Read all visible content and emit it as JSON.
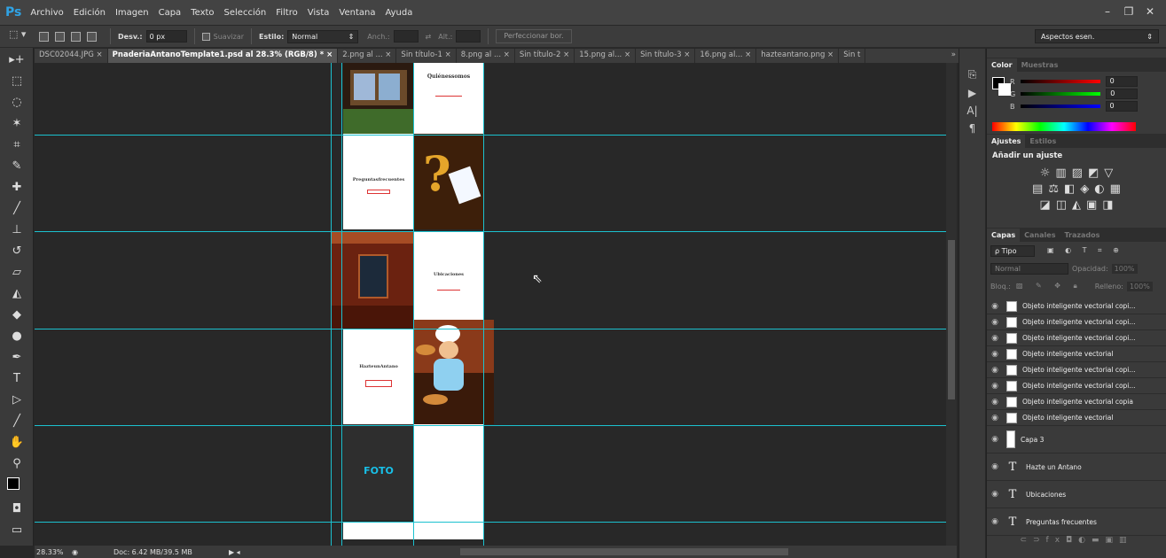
{
  "app": {
    "logo": "Ps",
    "menus": [
      "Archivo",
      "Edición",
      "Imagen",
      "Capa",
      "Texto",
      "Selección",
      "Filtro",
      "Vista",
      "Ventana",
      "Ayuda"
    ]
  },
  "window_controls": {
    "minimize": "–",
    "restore": "❐",
    "close": "✕"
  },
  "options": {
    "desv_label": "Desv.:",
    "desv_value": "0 px",
    "suavizar_label": "Suavizar",
    "estilo_label": "Estilo:",
    "estilo_value": "Normal",
    "anch_label": "Anch.:",
    "alt_label": "Alt.:",
    "perfeccionar": "Perfeccionar bor.",
    "workspace": "Aspectos esen."
  },
  "tabs": [
    {
      "label": "DSC02044.JPG ×"
    },
    {
      "label": "PnaderiaAntanoTemplate1.psd al 28.3% (RGB/8) * ×"
    },
    {
      "label": "2.png al ... ×"
    },
    {
      "label": "Sin título-1 ×"
    },
    {
      "label": "8.png al ... ×"
    },
    {
      "label": "Sin título-2 ×"
    },
    {
      "label": "15.png al... ×"
    },
    {
      "label": "Sin título-3 ×"
    },
    {
      "label": "16.png al... ×"
    },
    {
      "label": "hazteantano.png ×"
    },
    {
      "label": "Sin t"
    }
  ],
  "canvas": {
    "quienes": "Quiénessomos",
    "preguntas": "Preguntasfrecuentes",
    "ubicaciones": "Ubicaciones",
    "hazte": "HazteunAntano",
    "foto": "FOTO"
  },
  "status": {
    "zoom": "28.33%",
    "doc": "Doc: 6.42 MB/39.5 MB"
  },
  "color_panel": {
    "tab1": "Color",
    "tab2": "Muestras",
    "r_label": "R",
    "g_label": "G",
    "b_label": "B",
    "r": "0",
    "g": "0",
    "b": "0"
  },
  "adjust_panel": {
    "tab1": "Ajustes",
    "tab2": "Estilos",
    "title": "Añadir un ajuste"
  },
  "layers_panel": {
    "tab1": "Capas",
    "tab2": "Canales",
    "tab3": "Trazados",
    "filter": "ρ Tipo",
    "blend": "Normal",
    "opacity_label": "Opacidad:",
    "opacity": "100%",
    "lock_label": "Bloq.:",
    "fill_label": "Relleno:",
    "fill": "100%",
    "layers": [
      {
        "name": "Objeto inteligente vectorial copi..."
      },
      {
        "name": "Objeto inteligente vectorial copi..."
      },
      {
        "name": "Objeto inteligente vectorial copi..."
      },
      {
        "name": "Objeto inteligente vectorial"
      },
      {
        "name": "Objeto inteligente vectorial copi..."
      },
      {
        "name": "Objeto inteligente vectorial copi..."
      },
      {
        "name": "Objeto inteligente vectorial copia"
      },
      {
        "name": "Objeto inteligente vectorial"
      }
    ],
    "capa3": "Capa 3",
    "text_layers": [
      "Hazte un Antano",
      "Ubicaciones",
      "Preguntas frecuentes"
    ]
  }
}
